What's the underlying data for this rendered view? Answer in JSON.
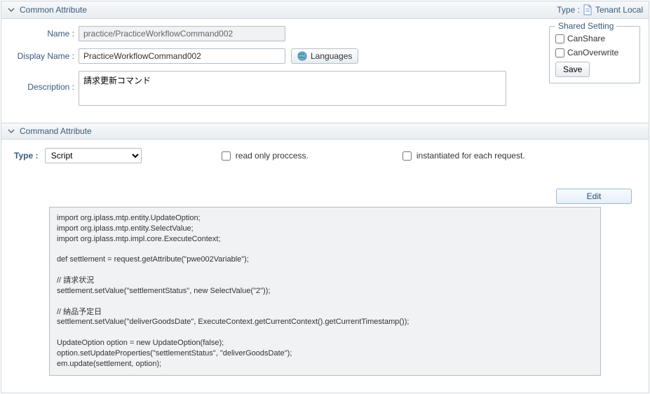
{
  "sections": {
    "common": {
      "title": "Common Attribute"
    },
    "command": {
      "title": "Command Attribute"
    }
  },
  "type_area": {
    "prefix": "Type :",
    "value": "Tenant Local"
  },
  "common": {
    "name_label": "Name :",
    "name_value": "practice/PracticeWorkflowCommand002",
    "display_label": "Display Name :",
    "display_value": "PracticeWorkflowCommand002",
    "description_label": "Description :",
    "description_value": "請求更新コマンド",
    "languages_button": "Languages"
  },
  "shared": {
    "legend": "Shared Setting",
    "can_share": "CanShare",
    "can_overwrite": "CanOverwrite",
    "save": "Save"
  },
  "command": {
    "type_label": "Type :",
    "type_value": "Script",
    "readonly_label": "read only proccess.",
    "instantiated_label": "instantiated for each request.",
    "edit_button": "Edit",
    "script": "import org.iplass.mtp.entity.UpdateOption;\nimport org.iplass.mtp.entity.SelectValue;\nimport org.iplass.mtp.impl.core.ExecuteContext;\n\ndef settlement = request.getAttribute(\"pwe002Variable\");\n\n// 請求状況\nsettlement.setValue(\"settlementStatus\", new SelectValue(\"2\"));\n\n// 納品予定日\nsettlement.setValue(\"deliverGoodsDate\", ExecuteContext.getCurrentContext().getCurrentTimestamp());\n\nUpdateOption option = new UpdateOption(false);\noption.setUpdateProperties(\"settlementStatus\", \"deliverGoodsDate\");\nem.update(settlement, option);"
  }
}
